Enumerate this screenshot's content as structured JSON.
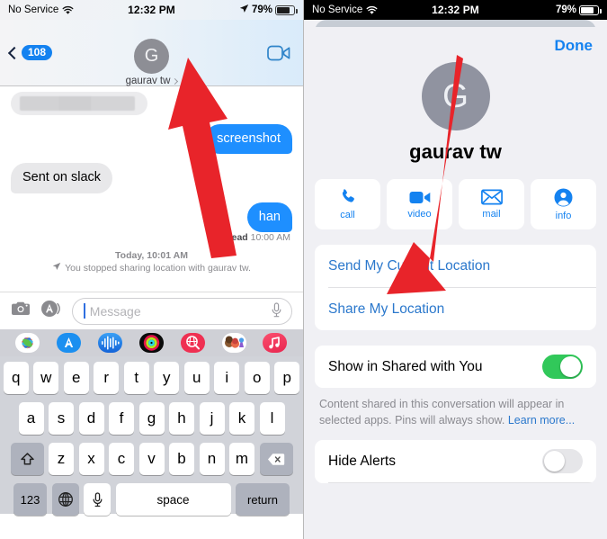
{
  "left_panel": {
    "status_bar": {
      "carrier": "No Service",
      "wifi_icon": "wifi-icon",
      "time": "12:32 PM",
      "location_icon": "location-arrow-icon",
      "battery_percent": "79%",
      "battery_icon": "battery-icon"
    },
    "nav_bar": {
      "back_icon": "chevron-left-icon",
      "unread_badge": "108",
      "avatar_initial": "G",
      "contact_name": "gaurav tw",
      "contact_chevron_icon": "chevron-right-icon",
      "facetime_icon": "video-camera-icon"
    },
    "thread": {
      "messages": [
        {
          "id": "m1",
          "side": "in",
          "type": "redacted",
          "text": ""
        },
        {
          "id": "m2",
          "side": "out",
          "type": "text",
          "text": "screenshot"
        },
        {
          "id": "m3",
          "side": "in",
          "type": "text",
          "text": "Sent on slack"
        },
        {
          "id": "m4",
          "side": "out",
          "type": "text",
          "text": "han"
        }
      ],
      "read_label": "Read",
      "read_time": "10:00 AM",
      "system_timestamp": "Today, 10:01 AM",
      "system_icon": "location-arrow-icon",
      "system_note": "You stopped sharing location with gaurav tw."
    },
    "input_bar": {
      "camera_icon": "camera-icon",
      "appstore_icon": "app-store-icon",
      "placeholder": "Message",
      "mic_icon": "microphone-icon"
    },
    "app_drawer": {
      "apps": [
        {
          "name": "photos-app-icon",
          "label": "Photos"
        },
        {
          "name": "app-store-app-icon",
          "label": "App Store"
        },
        {
          "name": "digital-touch-app-icon",
          "label": "Digital Touch"
        },
        {
          "name": "activity-app-icon",
          "label": "Activity"
        },
        {
          "name": "images-gif-app-icon",
          "label": "#images"
        },
        {
          "name": "memoji-app-icon",
          "label": "Memoji"
        },
        {
          "name": "music-app-icon",
          "label": "Music"
        }
      ]
    },
    "keyboard": {
      "row1": [
        "q",
        "w",
        "e",
        "r",
        "t",
        "y",
        "u",
        "i",
        "o",
        "p"
      ],
      "row2": [
        "a",
        "s",
        "d",
        "f",
        "g",
        "h",
        "j",
        "k",
        "l"
      ],
      "row3": [
        "z",
        "x",
        "c",
        "v",
        "b",
        "n",
        "m"
      ],
      "shift_icon": "shift-arrow-icon",
      "backspace_icon": "backspace-icon",
      "numbers_key": "123",
      "globe_icon": "globe-icon",
      "dictation_icon": "microphone-icon",
      "space_key": "space",
      "return_key": "return"
    }
  },
  "right_panel": {
    "status_bar": {
      "carrier": "No Service",
      "wifi_icon": "wifi-icon",
      "time": "12:32 PM",
      "battery_percent": "79%",
      "battery_icon": "battery-icon"
    },
    "sheet": {
      "done_label": "Done",
      "avatar_initial": "G",
      "contact_name": "gaurav tw",
      "actions": [
        {
          "icon": "phone-icon",
          "label": "call"
        },
        {
          "icon": "video-camera-icon",
          "label": "video"
        },
        {
          "icon": "envelope-icon",
          "label": "mail"
        },
        {
          "icon": "person-circle-icon",
          "label": "info"
        }
      ],
      "location_rows": [
        {
          "label": "Send My Current Location"
        },
        {
          "label": "Share My Location"
        }
      ],
      "shared_with_you": {
        "label": "Show in Shared with You",
        "toggle_state": "on"
      },
      "footnote_text": "Content shared in this conversation will appear in selected apps. Pins will always show. ",
      "footnote_link": "Learn more...",
      "hide_alerts": {
        "label": "Hide Alerts",
        "toggle_state": "off"
      }
    }
  },
  "annotations": {
    "arrow_left_name": "red-arrow-to-contact-name",
    "arrow_right_name": "red-arrow-to-send-my-current-location",
    "arrow_color": "#e8242a"
  },
  "colors": {
    "ios_blue": "#1482f0",
    "link_blue": "#2b78cc",
    "bubble_blue": "#1e8fff",
    "bubble_grey": "#e8e8ea",
    "toggle_green": "#31c85a",
    "sheet_bg": "#f0f0f4"
  }
}
